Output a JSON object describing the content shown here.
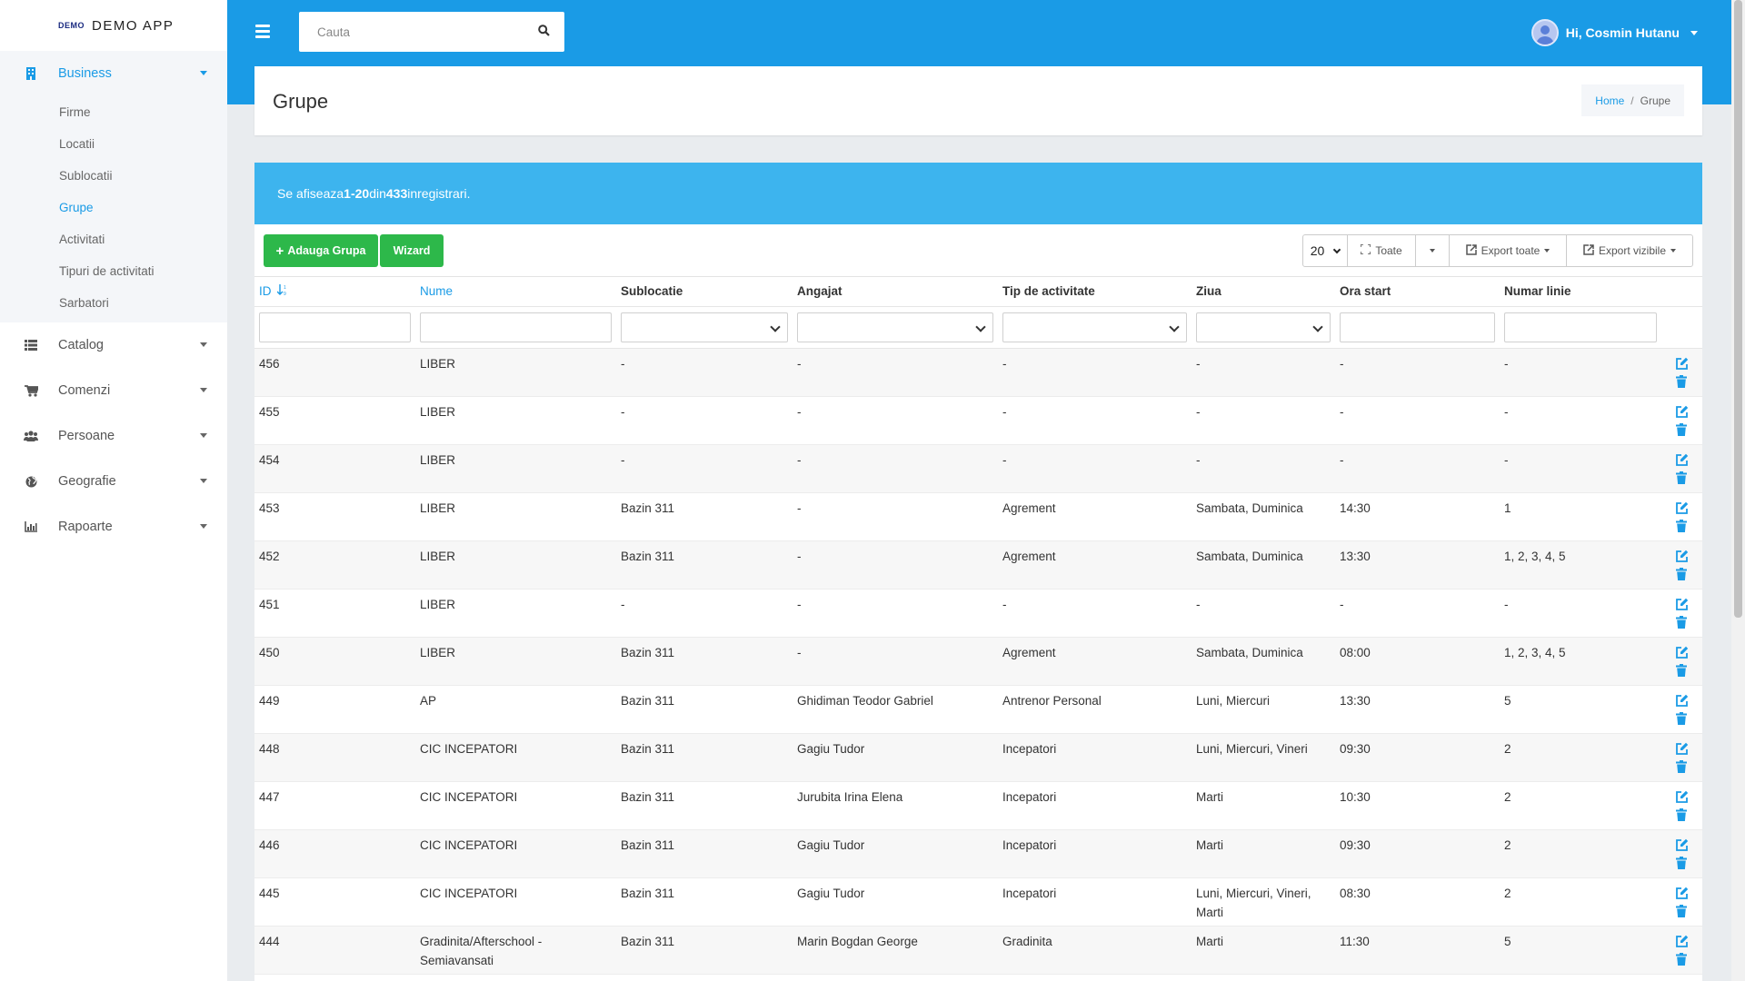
{
  "brand": {
    "logo": "DEMO",
    "name": "DEMO APP"
  },
  "sidebar": {
    "business": {
      "label": "Business"
    },
    "sub_items": [
      {
        "label": "Firme"
      },
      {
        "label": "Locatii"
      },
      {
        "label": "Sublocatii"
      },
      {
        "label": "Grupe"
      },
      {
        "label": "Activitati"
      },
      {
        "label": "Tipuri de activitati"
      },
      {
        "label": "Sarbatori"
      }
    ],
    "items": [
      {
        "label": "Catalog",
        "icon": "list-icon"
      },
      {
        "label": "Comenzi",
        "icon": "cart-icon"
      },
      {
        "label": "Persoane",
        "icon": "users-icon"
      },
      {
        "label": "Geografie",
        "icon": "globe-icon"
      },
      {
        "label": "Rapoarte",
        "icon": "chart-icon"
      }
    ]
  },
  "topbar": {
    "search_placeholder": "Cauta",
    "user_greeting": "Hi, Cosmin Hutanu"
  },
  "page": {
    "title": "Grupe",
    "breadcrumb": {
      "home": "Home",
      "separator": "/",
      "current": "Grupe"
    }
  },
  "summary": {
    "prefix": "Se afiseaza ",
    "range": "1-20",
    "middle": " din ",
    "total": "433",
    "suffix": " inregistrari."
  },
  "toolbar": {
    "add_label": "Adauga Grupa",
    "wizard_label": "Wizard",
    "page_size": "20",
    "toate_label": "Toate",
    "export_all_label": "Export toate",
    "export_visible_label": "Export vizibile"
  },
  "columns": [
    {
      "label": "ID"
    },
    {
      "label": "Nume"
    },
    {
      "label": "Sublocatie"
    },
    {
      "label": "Angajat"
    },
    {
      "label": "Tip de activitate"
    },
    {
      "label": "Ziua"
    },
    {
      "label": "Ora start"
    },
    {
      "label": "Numar linie"
    }
  ],
  "rows": [
    [
      "456",
      "LIBER",
      "-",
      "-",
      "-",
      "-",
      "-",
      "-"
    ],
    [
      "455",
      "LIBER",
      "-",
      "-",
      "-",
      "-",
      "-",
      "-"
    ],
    [
      "454",
      "LIBER",
      "-",
      "-",
      "-",
      "-",
      "-",
      "-"
    ],
    [
      "453",
      "LIBER",
      "Bazin 311",
      "-",
      "Agrement",
      "Sambata, Duminica",
      "14:30",
      "1"
    ],
    [
      "452",
      "LIBER",
      "Bazin 311",
      "-",
      "Agrement",
      "Sambata, Duminica",
      "13:30",
      "1, 2, 3, 4, 5"
    ],
    [
      "451",
      "LIBER",
      "-",
      "-",
      "-",
      "-",
      "-",
      "-"
    ],
    [
      "450",
      "LIBER",
      "Bazin 311",
      "-",
      "Agrement",
      "Sambata, Duminica",
      "08:00",
      "1, 2, 3, 4, 5"
    ],
    [
      "449",
      "AP",
      "Bazin 311",
      "Ghidiman Teodor Gabriel",
      "Antrenor Personal",
      "Luni, Miercuri",
      "13:30",
      "5"
    ],
    [
      "448",
      "CIC INCEPATORI",
      "Bazin 311",
      "Gagiu Tudor",
      "Incepatori",
      "Luni, Miercuri, Vineri",
      "09:30",
      "2"
    ],
    [
      "447",
      "CIC INCEPATORI",
      "Bazin 311",
      "Jurubita Irina Elena",
      "Incepatori",
      "Marti",
      "10:30",
      "2"
    ],
    [
      "446",
      "CIC INCEPATORI",
      "Bazin 311",
      "Gagiu Tudor",
      "Incepatori",
      "Marti",
      "09:30",
      "2"
    ],
    [
      "445",
      "CIC INCEPATORI",
      "Bazin 311",
      "Gagiu Tudor",
      "Incepatori",
      "Luni, Miercuri, Vineri, Marti",
      "08:30",
      "2"
    ],
    [
      "444",
      "Gradinita/Afterschool - Semiavansati",
      "Bazin 311",
      "Marin Bogdan George",
      "Gradinita",
      "Marti",
      "11:30",
      "5"
    ]
  ],
  "colors": {
    "accent": "#1a9be6",
    "info": "#3db4ee",
    "success": "#2db84a"
  }
}
